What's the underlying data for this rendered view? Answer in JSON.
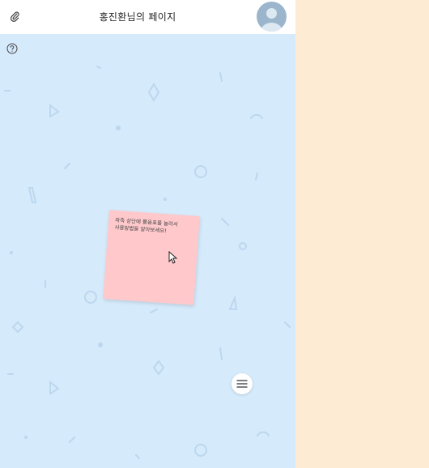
{
  "header": {
    "title": "홍진환님의 페이지",
    "attach_icon": "paperclip-icon",
    "avatar_icon": "user-avatar-icon"
  },
  "help": {
    "icon": "question-circle-icon"
  },
  "sticky_note": {
    "text": "좌측 상단에 물음표를 눌러서\n사용방법을 알아보세요!",
    "color": "#ffc9cc"
  },
  "menu": {
    "icon": "hamburger-menu-icon"
  },
  "colors": {
    "canvas": "#d5eafb",
    "side_panel": "#fdebd3",
    "header": "#ffffff",
    "avatar": "#9bb6cc"
  }
}
